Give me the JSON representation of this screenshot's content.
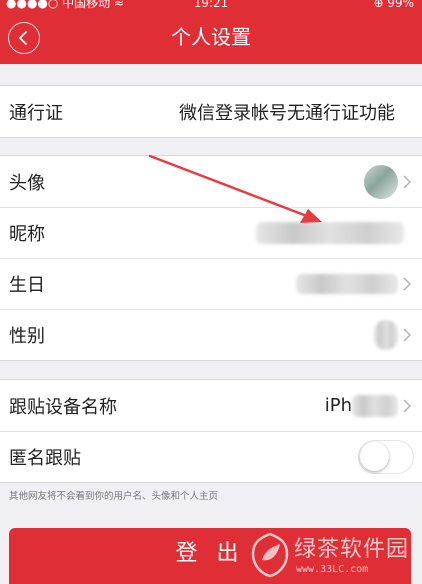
{
  "status_bar": {
    "carrier": "●●●●○ 中国移动 ≈",
    "time": "19:21",
    "battery": "⊕ 99%"
  },
  "header": {
    "title": "个人设置",
    "back_icon": "chevron-left-icon"
  },
  "groups": {
    "passport": {
      "label": "通行证",
      "value": "微信登录帐号无通行证功能"
    },
    "profile": {
      "avatar_label": "头像",
      "nickname_label": "昵称",
      "birthday_label": "生日",
      "gender_label": "性别"
    },
    "device": {
      "device_name_label": "跟贴设备名称",
      "device_name_value": "iPh",
      "anonymous_label": "匿名跟贴",
      "anonymous_enabled": false
    }
  },
  "hint": "其他网友将不会看到你的用户名、头像和个人主页",
  "logout_label": "登 出",
  "watermark": {
    "text": "绿茶软件园",
    "url": "www.33LC.com"
  },
  "colors": {
    "brand_red": "#e02e36",
    "background": "#efeff4"
  }
}
